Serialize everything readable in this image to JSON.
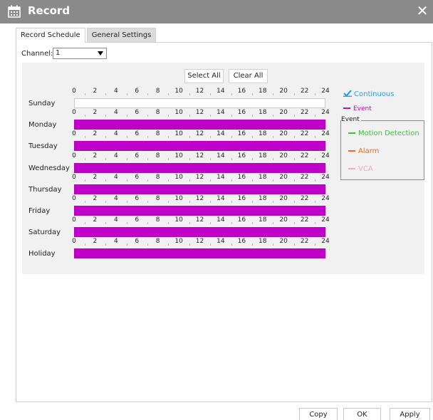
{
  "window": {
    "title": "Record",
    "close_label": "✕"
  },
  "tabs": [
    {
      "label": "Record Schedule",
      "active": true
    },
    {
      "label": "General Settings",
      "active": false
    }
  ],
  "channel": {
    "label": "Channel:",
    "value": "1"
  },
  "toolbar": {
    "select_all": "Select All",
    "clear_all": "Clear All"
  },
  "hours": [
    "0",
    "2",
    "4",
    "6",
    "8",
    "10",
    "12",
    "14",
    "16",
    "18",
    "20",
    "22",
    "24"
  ],
  "days": [
    {
      "label": "Sunday",
      "scheduled": false
    },
    {
      "label": "Monday",
      "scheduled": true
    },
    {
      "label": "Tuesday",
      "scheduled": true
    },
    {
      "label": "Wednesday",
      "scheduled": true
    },
    {
      "label": "Thursday",
      "scheduled": true
    },
    {
      "label": "Friday",
      "scheduled": true
    },
    {
      "label": "Saturday",
      "scheduled": true
    },
    {
      "label": "Holiday",
      "scheduled": true
    }
  ],
  "legend": {
    "continuous": {
      "label": "Continuous",
      "color": "#2aa0e0",
      "checked": true
    },
    "event": {
      "label": "Event",
      "color": "#c000c8"
    },
    "event_group_title": "Event",
    "event_types": [
      {
        "label": "Motion Detection",
        "color": "#3cc03c"
      },
      {
        "label": "Alarm",
        "color": "#f06a20"
      },
      {
        "label": "VCA",
        "color": "#f4a8c4"
      }
    ]
  },
  "footer": {
    "copy": "Copy",
    "ok": "OK",
    "apply": "Apply"
  },
  "colors": {
    "schedule_fill": "#c000c8",
    "title_bar": "#8a8a8a",
    "grid_background": "#f1f1f1"
  }
}
